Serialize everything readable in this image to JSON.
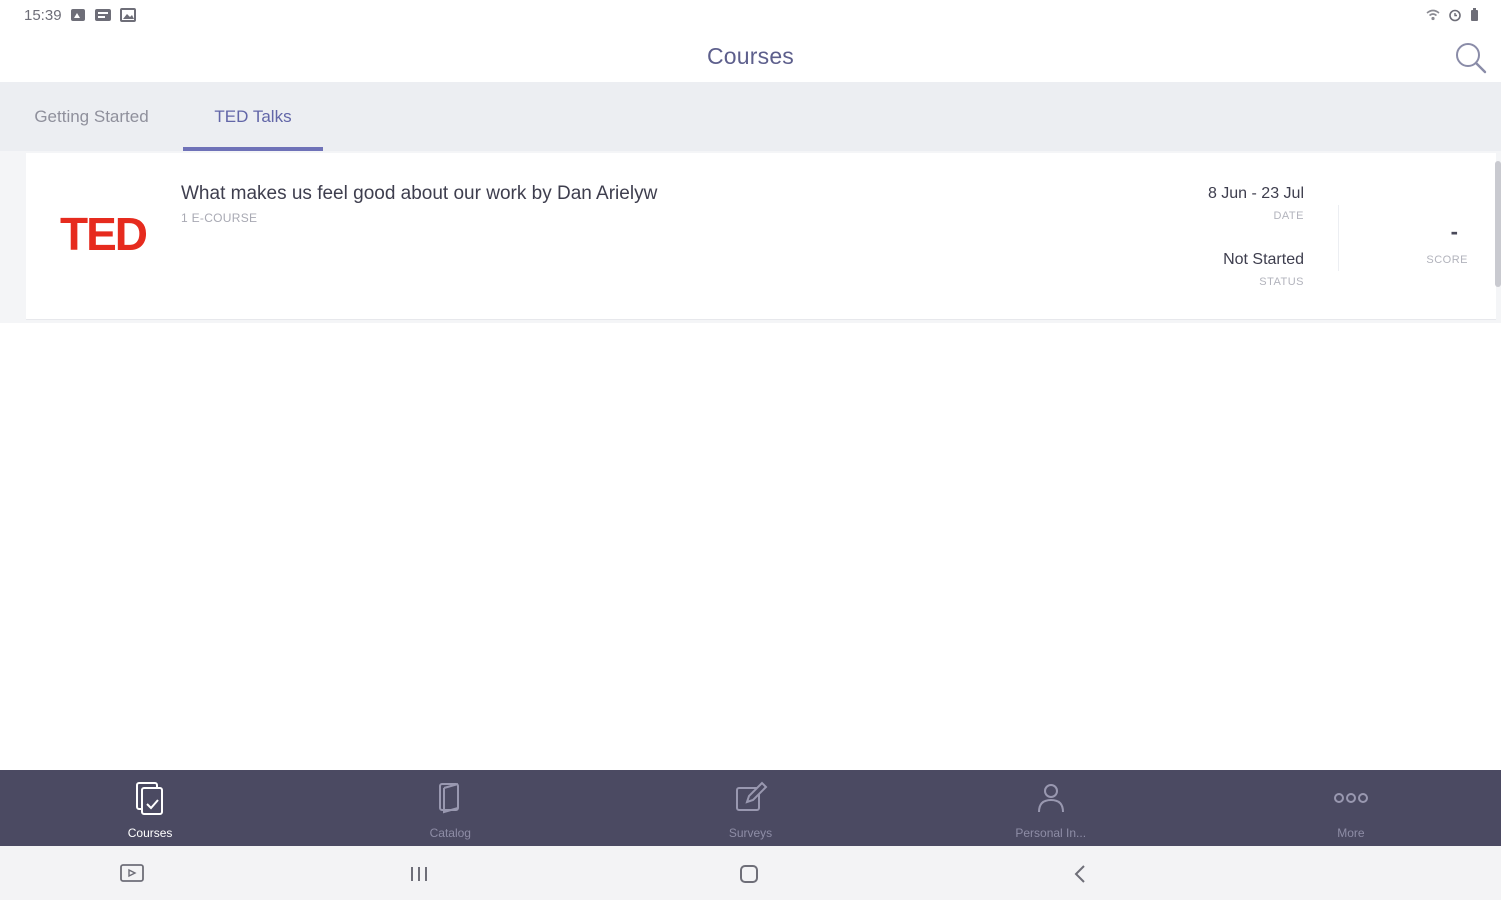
{
  "status_bar": {
    "time": "15:39",
    "left_icons": [
      "photo-badge-icon",
      "message-icon",
      "gallery-icon"
    ],
    "right_icons": [
      "wifi-icon",
      "alarm-icon",
      "battery-icon"
    ]
  },
  "header": {
    "title": "Courses",
    "search_icon": "search-icon"
  },
  "tabs": [
    {
      "label": "Getting Started",
      "active": false
    },
    {
      "label": "TED Talks",
      "active": true
    }
  ],
  "course": {
    "logo_text": "TED",
    "title": "What makes us feel good about our work by Dan Arielyw",
    "type": "1 E-COURSE",
    "date_value": "8 Jun - 23 Jul",
    "date_label": "DATE",
    "status_value": "Not Started",
    "status_label": "STATUS",
    "score_value": "-",
    "score_label": "SCORE"
  },
  "bottom_nav": [
    {
      "label": "Courses",
      "icon": "courses-icon",
      "active": true
    },
    {
      "label": "Catalog",
      "icon": "catalog-icon",
      "active": false
    },
    {
      "label": "Surveys",
      "icon": "surveys-icon",
      "active": false
    },
    {
      "label": "Personal In...",
      "icon": "person-icon",
      "active": false
    },
    {
      "label": "More",
      "icon": "more-icon",
      "active": false
    }
  ],
  "colors": {
    "accent": "#6f72b8",
    "nav_background": "#4b4a62",
    "ted_red": "#e62b1e"
  }
}
